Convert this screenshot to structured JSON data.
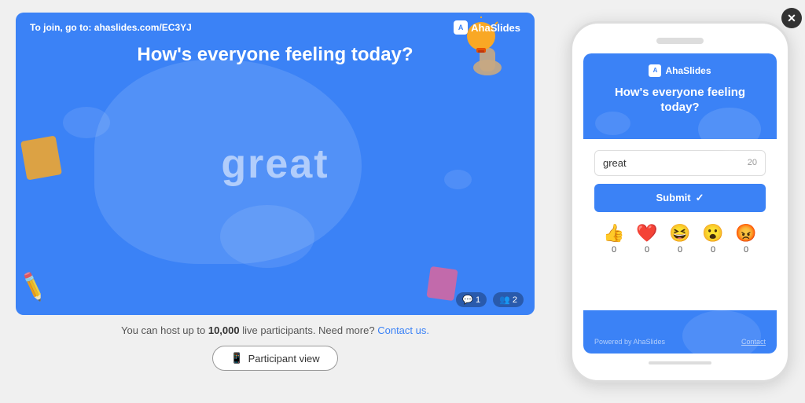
{
  "slide": {
    "join_text": "To join, go to:",
    "join_url": "ahaslides.com/EC3YJ",
    "logo": "AhaSlides",
    "title": "How's everyone feeling today?",
    "word": "great",
    "participants": {
      "responses": "1",
      "users": "2"
    }
  },
  "below_slide": {
    "info_text": "You can host up to ",
    "limit": "10,000",
    "info_text2": " live participants. Need more?",
    "contact_link": "Contact us.",
    "participant_view_label": "Participant view"
  },
  "phone": {
    "logo": "AhaSlides",
    "question": "How's everyone feeling today?",
    "input_value": "great",
    "input_count": "20",
    "submit_label": "Submit",
    "reactions": [
      {
        "emoji": "👍",
        "count": "0"
      },
      {
        "emoji": "❤️",
        "count": "0"
      },
      {
        "emoji": "😆",
        "count": "0"
      },
      {
        "emoji": "😮",
        "count": "0"
      },
      {
        "emoji": "😡",
        "count": "0"
      }
    ],
    "footer_powered": "Powered by AhaSlides",
    "footer_link": "Contact"
  },
  "close_button": "✕",
  "icons": {
    "mobile": "📱",
    "checkmark": "✓",
    "person": "👤",
    "message": "💬"
  }
}
